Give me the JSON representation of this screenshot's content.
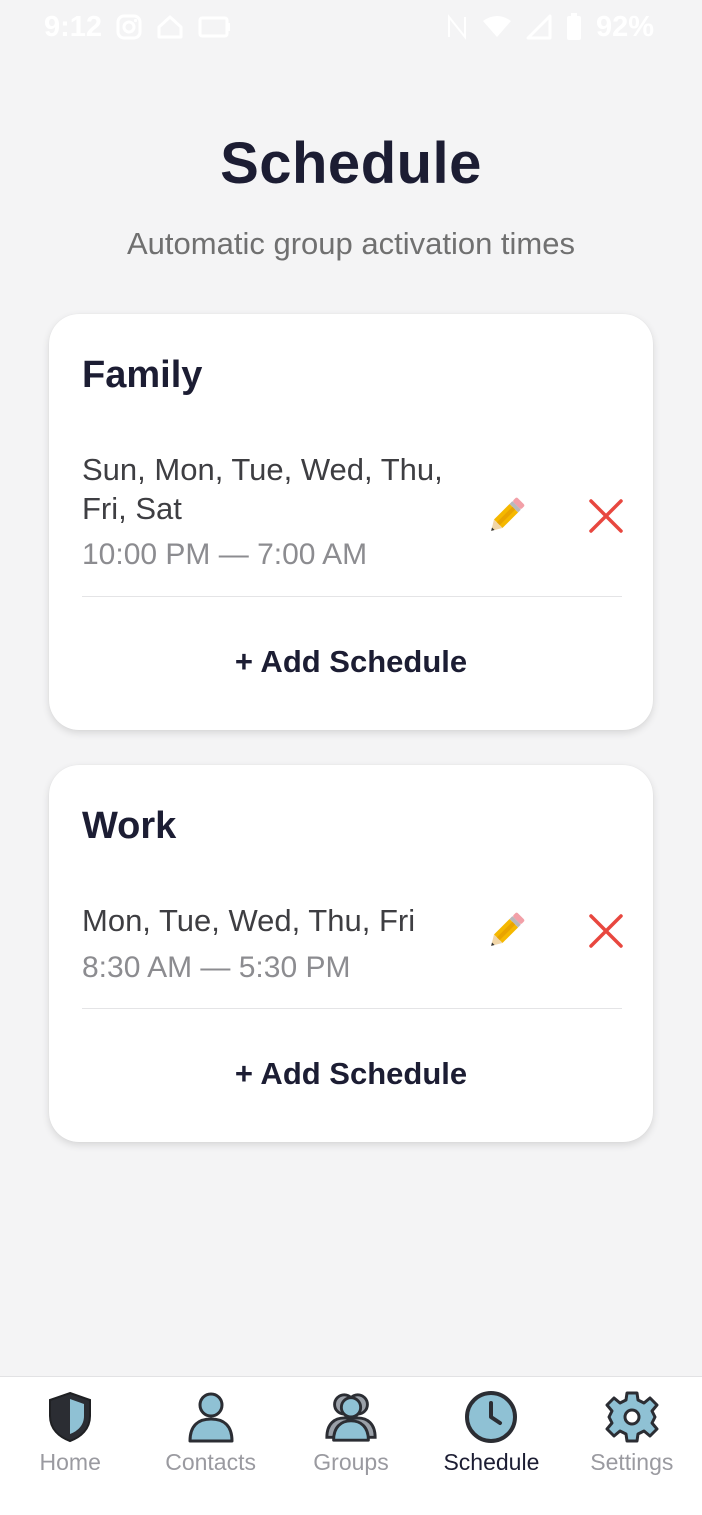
{
  "status_bar": {
    "time": "9:12",
    "battery": "92%",
    "icons": [
      "instagram-icon",
      "home-icon",
      "card-icon",
      "nfc-icon",
      "wifi-icon",
      "signal-icon",
      "battery-icon"
    ]
  },
  "header": {
    "title": "Schedule",
    "subtitle": "Automatic group activation times"
  },
  "groups": [
    {
      "name": "Family",
      "schedules": [
        {
          "days": "Sun, Mon, Tue, Wed, Thu, Fri, Sat",
          "times": "10:00 PM — 7:00 AM"
        }
      ],
      "add_label": "+ Add Schedule"
    },
    {
      "name": "Work",
      "schedules": [
        {
          "days": "Mon, Tue, Wed, Thu, Fri",
          "times": "8:30 AM — 5:30 PM"
        }
      ],
      "add_label": "+ Add Schedule"
    }
  ],
  "icons": {
    "edit": "pencil-icon",
    "delete": "close-icon"
  },
  "colors": {
    "accent_icon": "#8fc1d4",
    "delete_red": "#e8473f",
    "text_dark": "#1c1d33",
    "nav_inactive": "#9a9aa0"
  },
  "bottom_nav": {
    "items": [
      {
        "label": "Home",
        "icon": "shield-icon",
        "active": false
      },
      {
        "label": "Contacts",
        "icon": "person-icon",
        "active": false
      },
      {
        "label": "Groups",
        "icon": "group-icon",
        "active": false
      },
      {
        "label": "Schedule",
        "icon": "clock-icon",
        "active": true
      },
      {
        "label": "Settings",
        "icon": "gear-icon",
        "active": false
      }
    ]
  }
}
